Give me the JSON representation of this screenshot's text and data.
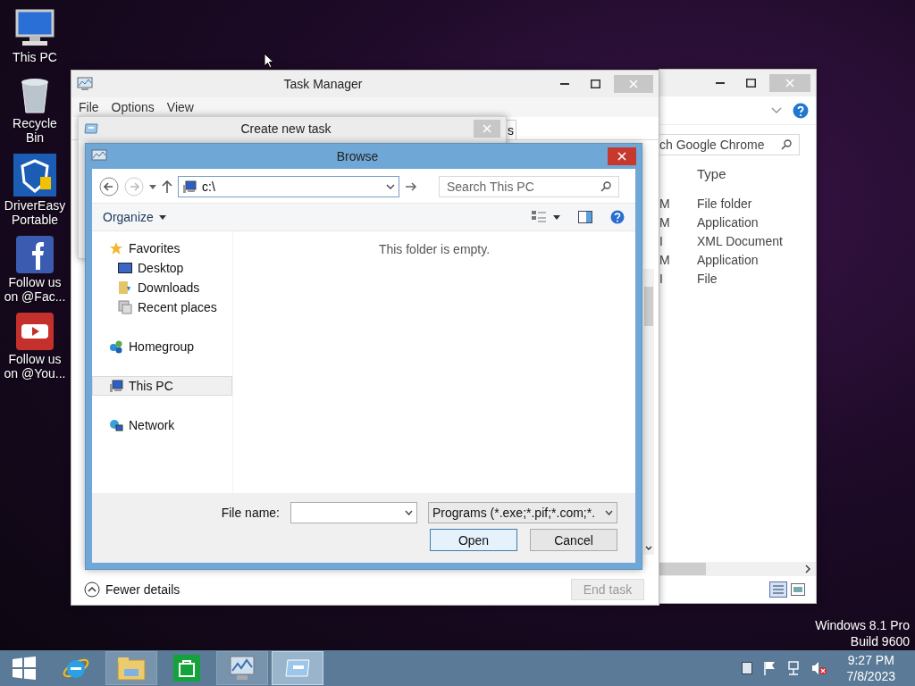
{
  "desktop_icons": [
    {
      "kind": "pc",
      "label": "This PC"
    },
    {
      "kind": "bin",
      "label": "Recycle Bin"
    },
    {
      "kind": "shield",
      "label": "DriverEasy Portable"
    },
    {
      "kind": "facebook",
      "label": "Follow us on @Fac..."
    },
    {
      "kind": "youtube",
      "label": "Follow us on @You..."
    }
  ],
  "explorer_window": {
    "search": {
      "placeholder": "ch Google Chrome"
    },
    "columns": [
      "Type"
    ],
    "rows": [
      {
        "column_1": "M",
        "type": "File folder"
      },
      {
        "column_1": "M",
        "type": "Application"
      },
      {
        "column_1": "I",
        "type": "XML Document"
      },
      {
        "column_1": "M",
        "type": "Application"
      },
      {
        "column_1": "I",
        "type": "File"
      }
    ]
  },
  "task_manager": {
    "title": "Task Manager",
    "menu": [
      "File",
      "Options",
      "View"
    ],
    "tab_fragment": "s",
    "footer_toggle": "Fewer details",
    "end_task": {
      "label": "End task",
      "disabled": true
    }
  },
  "create_task_dialog": {
    "title": "Create new task"
  },
  "browse_dialog": {
    "title": "Browse",
    "address": "c:\\",
    "search": {
      "placeholder": "Search This PC"
    },
    "organize": "Organize",
    "nav": [
      {
        "kind": "favorites",
        "label": "Favorites",
        "selected": false,
        "children": [
          {
            "kind": "desktop",
            "label": "Desktop",
            "selected": false
          },
          {
            "kind": "downloads",
            "label": "Downloads",
            "selected": false
          },
          {
            "kind": "recent",
            "label": "Recent places",
            "selected": false
          }
        ]
      },
      {
        "kind": "homegroup",
        "label": "Homegroup",
        "selected": false
      },
      {
        "kind": "pc",
        "label": "This PC",
        "selected": true
      },
      {
        "kind": "network",
        "label": "Network",
        "selected": false
      }
    ],
    "empty_message": "This folder is empty.",
    "file_name_label": "File name:",
    "filter": "Programs (*.exe;*.pif;*.com;*.",
    "buttons": [
      {
        "label": "Open",
        "default": true
      },
      {
        "label": "Cancel",
        "default": false
      }
    ]
  },
  "os_watermark": [
    "Windows 8.1 Pro",
    "Build 9600"
  ],
  "taskbar": {
    "apps": [
      {
        "kind": "ie",
        "open": false,
        "selected": false
      },
      {
        "kind": "explorer",
        "open": true,
        "selected": false
      },
      {
        "kind": "store",
        "open": false,
        "selected": false
      },
      {
        "kind": "taskmgr",
        "open": true,
        "selected": false
      },
      {
        "kind": "run",
        "open": true,
        "selected": true
      }
    ],
    "time": "9:27 PM",
    "date": "7/8/2023"
  }
}
